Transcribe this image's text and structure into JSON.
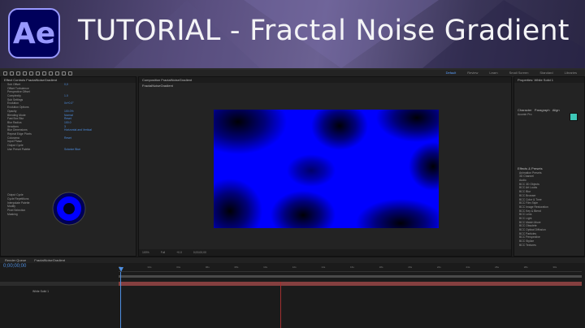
{
  "banner": {
    "logo_text": "Ae",
    "title": "TUTORIAL - Fractal Noise Gradient",
    "colors": {
      "logo_bg": "#00005b",
      "logo_fg": "#9999ff",
      "banner_accent": "#5a4f80"
    }
  },
  "workspaces": [
    {
      "label": "Default",
      "active": true
    },
    {
      "label": "Review",
      "active": false
    },
    {
      "label": "Learn",
      "active": false
    },
    {
      "label": "Small Screen",
      "active": false
    },
    {
      "label": "Standard",
      "active": false
    },
    {
      "label": "Libraries",
      "active": false
    }
  ],
  "effects_panel": {
    "tab": "Effect Controls FractalNoiseGradient",
    "rows": [
      {
        "label": "Sub Offset",
        "value": "0,0"
      },
      {
        "label": "Offset Turbulence",
        "value": ""
      },
      {
        "label": "Perspective Offset",
        "value": ""
      },
      {
        "label": "Complexity",
        "value": "1.0"
      },
      {
        "label": "Sub Settings",
        "value": ""
      },
      {
        "label": "Evolution",
        "value": "0x+0.0°"
      },
      {
        "label": "Evolution Options",
        "value": ""
      },
      {
        "label": "Opacity",
        "value": "100.0%"
      },
      {
        "label": "Blending Mode",
        "value": "Normal"
      },
      {
        "label": "Fast Box Blur",
        "value": "Reset"
      },
      {
        "label": "Blur Radius",
        "value": "100.0"
      },
      {
        "label": "Iterations",
        "value": "3"
      },
      {
        "label": "Blur Dimensions",
        "value": "Horizontal and Vertical"
      },
      {
        "label": "Repeat Edge Pixels",
        "value": ""
      },
      {
        "label": "Colorama",
        "value": "Reset"
      },
      {
        "label": "Input Phase",
        "value": ""
      },
      {
        "label": "Output Cycle",
        "value": ""
      },
      {
        "label": "Use Preset Palette",
        "value": "Solarize Blue"
      },
      {
        "label": "Output Cycle",
        "value": ""
      },
      {
        "label": "Cycle Repetitions",
        "value": "1.00"
      },
      {
        "label": "Interpolate Palette",
        "value": ""
      },
      {
        "label": "Modify",
        "value": ""
      },
      {
        "label": "Pixel Selection",
        "value": ""
      },
      {
        "label": "Masking",
        "value": ""
      }
    ]
  },
  "comp_panel": {
    "tab": "Composition FractalNoiseGradient",
    "sub_tab": "FractalNoiseGradient",
    "viewer_bar": [
      "100%",
      "Full",
      "+0.0",
      "0;00;00;00"
    ]
  },
  "right_panel": {
    "tabs": [
      "Properties: White Solid 1",
      "Character",
      "Paragraph",
      "Align"
    ],
    "font": "Acumin Pro",
    "section": "Effects & Presets",
    "items": [
      "Animation Presets",
      "3D Channel",
      "Audio",
      "BCC 3D Objects",
      "BCC Art Looks",
      "BCC Blur",
      "BCC Browser",
      "BCC Color & Tone",
      "BCC Film Style",
      "BCC Image Restoration",
      "BCC Key & Blend",
      "BCC Lens",
      "BCC Light",
      "BCC Match Move",
      "BCC Obsolete",
      "BCC Optical Diffusion",
      "BCC Particles",
      "BCC Perspective",
      "BCC Stylize",
      "BCC Textures"
    ]
  },
  "timeline": {
    "tabs": [
      "Render Queue",
      "FractalNoiseGradient"
    ],
    "timecode": "0;00;00;00",
    "layer_name": "White Solid 1",
    "ticks": [
      "0s",
      "02s",
      "04s",
      "06s",
      "08s",
      "10s",
      "12s",
      "14s",
      "16s",
      "18s",
      "20s",
      "22s",
      "24s",
      "26s",
      "28s",
      "30s"
    ]
  }
}
